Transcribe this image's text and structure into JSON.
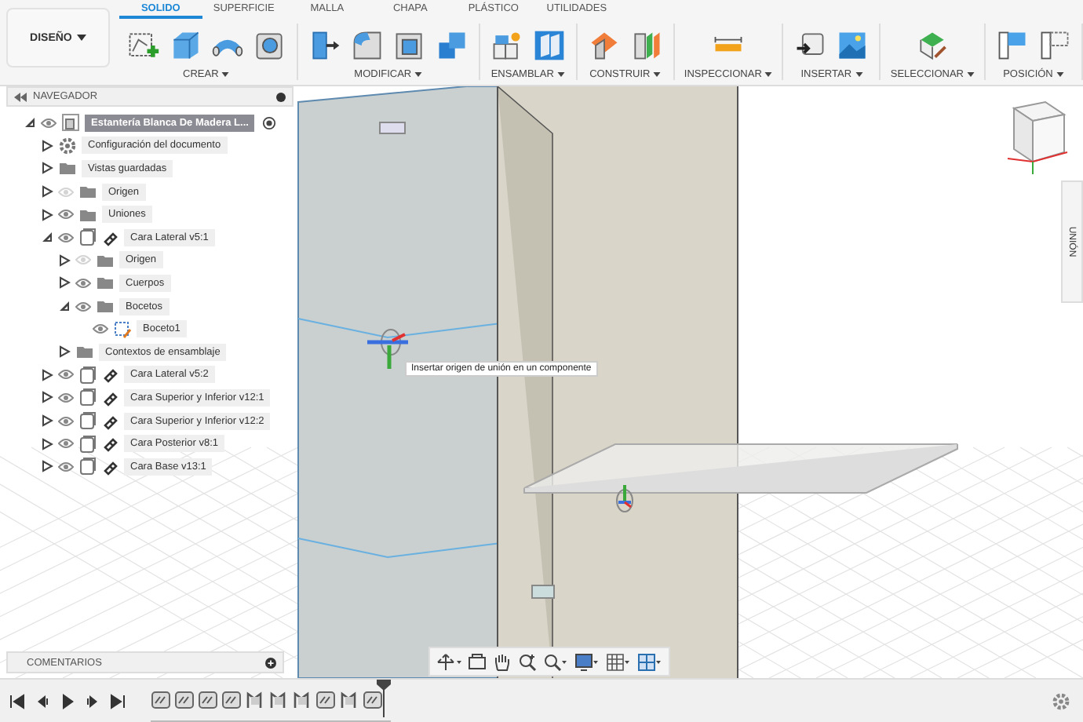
{
  "workspace": {
    "label": "DISEÑO"
  },
  "tabs": [
    {
      "label": "SOLIDO",
      "selected": true
    },
    {
      "label": "SUPERFICIE",
      "selected": false
    },
    {
      "label": "MALLA",
      "selected": false
    },
    {
      "label": "CHAPA",
      "selected": false
    },
    {
      "label": "PLÁSTICO",
      "selected": false
    },
    {
      "label": "UTILIDADES",
      "selected": false
    }
  ],
  "groups": [
    {
      "label": "CREAR",
      "tools": [
        {
          "kind": "sketch"
        },
        {
          "kind": "extrude"
        },
        {
          "kind": "sweep"
        },
        {
          "kind": "hole"
        }
      ]
    },
    {
      "label": "MODIFICAR",
      "tools": [
        {
          "kind": "pushpull"
        },
        {
          "kind": "fillet"
        },
        {
          "kind": "shell"
        },
        {
          "kind": "combine"
        }
      ]
    },
    {
      "label": "ENSAMBLAR",
      "tools": [
        {
          "kind": "component"
        },
        {
          "kind": "joint"
        }
      ]
    },
    {
      "label": "CONSTRUIR",
      "tools": [
        {
          "kind": "plane"
        },
        {
          "kind": "midplane"
        }
      ]
    },
    {
      "label": "INSPECCIONAR",
      "tools": [
        {
          "kind": "measure"
        }
      ]
    },
    {
      "label": "INSERTAR",
      "tools": [
        {
          "kind": "derive"
        },
        {
          "kind": "image"
        }
      ]
    },
    {
      "label": "SELECCIONAR",
      "tools": [
        {
          "kind": "select"
        }
      ]
    },
    {
      "label": "POSICIÓN",
      "tools": [
        {
          "kind": "capture"
        },
        {
          "kind": "revert"
        }
      ]
    }
  ],
  "browser": {
    "title": "NAVEGADOR",
    "items": [
      {
        "kind": "root",
        "label": "Estantería Blanca De Madera L...",
        "expanded": true,
        "visible": true,
        "children": [
          {
            "kind": "settings",
            "label": "Configuración del documento",
            "expanded": false
          },
          {
            "kind": "folder",
            "label": "Vistas guardadas",
            "expanded": false
          },
          {
            "kind": "folder",
            "label": "Origen",
            "expanded": false,
            "visible": false
          },
          {
            "kind": "folder",
            "label": "Uniones",
            "expanded": false,
            "visible": true
          },
          {
            "kind": "component",
            "label": "Cara Lateral v5:1",
            "expanded": true,
            "visible": true,
            "children": [
              {
                "kind": "folder",
                "label": "Origen",
                "expanded": false,
                "visible": false
              },
              {
                "kind": "folder",
                "label": "Cuerpos",
                "expanded": false,
                "visible": true
              },
              {
                "kind": "folder",
                "label": "Bocetos",
                "expanded": true,
                "visible": true,
                "children": [
                  {
                    "kind": "sketch",
                    "label": "Boceto1",
                    "visible": true
                  }
                ]
              },
              {
                "kind": "folder",
                "label": "Contextos de ensamblaje",
                "expanded": false
              }
            ]
          },
          {
            "kind": "component",
            "label": "Cara Lateral v5:2",
            "expanded": false,
            "visible": true
          },
          {
            "kind": "component",
            "label": "Cara Superior y Inferior v12:1",
            "expanded": false,
            "visible": true
          },
          {
            "kind": "component",
            "label": "Cara Superior y Inferior v12:2",
            "expanded": false,
            "visible": true
          },
          {
            "kind": "component",
            "label": "Cara Posterior v8:1",
            "expanded": false,
            "visible": true
          },
          {
            "kind": "component",
            "label": "Cara Base v13:1",
            "expanded": false,
            "visible": true
          }
        ]
      }
    ]
  },
  "viewport": {
    "tooltip": "Insertar origen de unión en un componente",
    "side_tab": "UNIÓN"
  },
  "comments": {
    "title": "COMENTARIOS"
  },
  "timeline": {
    "features": [
      {
        "kind": "joint"
      },
      {
        "kind": "joint"
      },
      {
        "kind": "joint"
      },
      {
        "kind": "joint"
      },
      {
        "kind": "rigid"
      },
      {
        "kind": "rigid"
      },
      {
        "kind": "rigid"
      },
      {
        "kind": "joint"
      },
      {
        "kind": "rigid"
      },
      {
        "kind": "joint"
      }
    ]
  }
}
